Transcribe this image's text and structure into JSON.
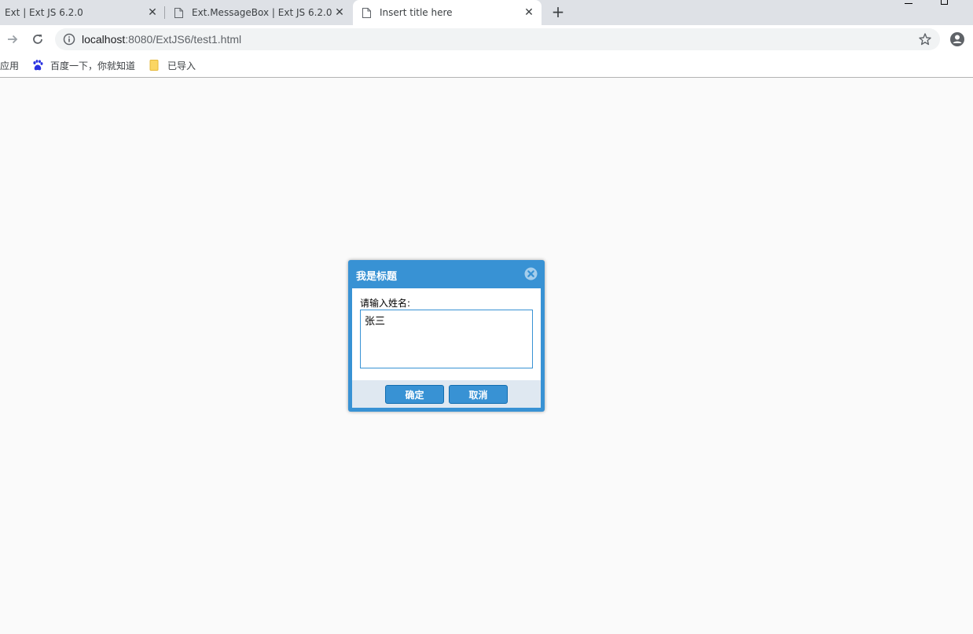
{
  "browser": {
    "tabs": [
      {
        "title": "Ext | Ext JS 6.2.0",
        "active": false
      },
      {
        "title": "Ext.MessageBox | Ext JS 6.2.0 -",
        "active": false
      },
      {
        "title": "Insert title here",
        "active": true
      }
    ],
    "new_tab_glyph": "+",
    "close_glyph": "✕",
    "address": {
      "host": "localhost",
      "path": ":8080/ExtJS6/test1.html"
    },
    "bookmarks": [
      {
        "label": "应用",
        "icon": "apps-icon"
      },
      {
        "label": "百度一下，你就知道",
        "icon": "baidu-paw-icon"
      },
      {
        "label": "已导入",
        "icon": "folder-icon"
      }
    ]
  },
  "dialog": {
    "title": "我是标题",
    "message": "请输入姓名:",
    "input_value": "张三",
    "ok_label": "确定",
    "cancel_label": "取消"
  },
  "colors": {
    "accent": "#3892d4",
    "footer": "#dfe8f1",
    "page_bg": "#fafafa",
    "tabstrip_bg": "#dee1e6"
  }
}
